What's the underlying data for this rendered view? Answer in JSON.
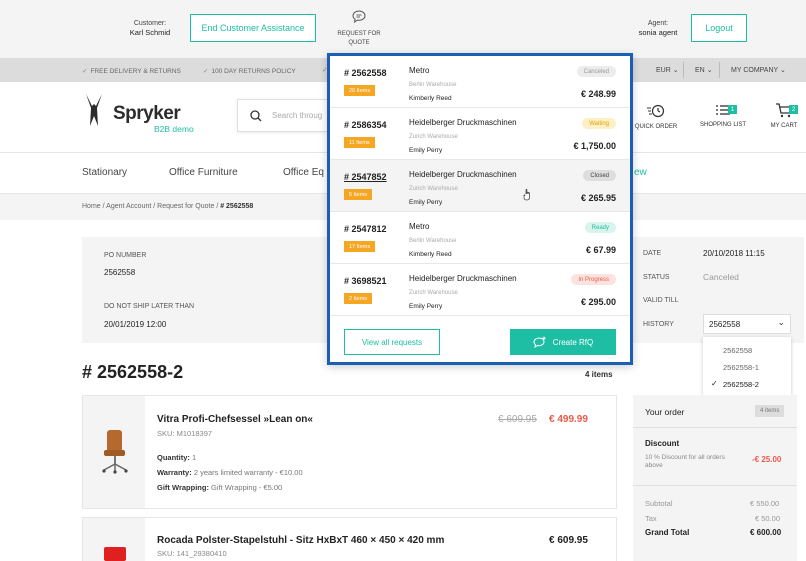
{
  "topbar": {
    "customer_label": "Customer:",
    "customer_name": "Karl Schmid",
    "end_assistance": "End Customer Assistance",
    "rfq_label_1": "REQUEST FOR",
    "rfq_label_2": "QUOTE",
    "agent_label": "Agent:",
    "agent_name": "sonia agent",
    "logout": "Logout"
  },
  "promo": {
    "delivery": "FREE DELIVERY & RETURNS",
    "returns": "100 DAY RETURNS POLICY",
    "currency": "EUR",
    "language": "EN",
    "company": "MY COMPANY"
  },
  "header": {
    "logo_text": "Spryker",
    "logo_sub": "B2B demo",
    "search_placeholder": "Search throug",
    "quick_order": "QUICK ORDER",
    "shopping_list": "SHOPPING LIST",
    "shopping_list_count": "1",
    "my_cart": "MY CART",
    "cart_count": "2"
  },
  "nav": {
    "items": [
      "Stationary",
      "Office Furniture",
      "Office Eq"
    ],
    "partial": "ew"
  },
  "breadcrumb": {
    "items": [
      "Home",
      "Agent Account",
      "Request for Quote",
      "# 2562558"
    ]
  },
  "meta": {
    "po_label": "PO NUMBER",
    "po_value": "2562558",
    "ship_label": "DO NOT SHIP LATER THAN",
    "ship_value": "20/01/2019 12:00",
    "date_label": "DATE",
    "date_value": "20/10/2018 11:15",
    "status_label": "STATUS",
    "status_value": "Canceled",
    "valid_label": "VALID TILL",
    "history_label": "HISTORY",
    "history_value": "2562558",
    "history_options": [
      "2562558",
      "2562558-1",
      "2562558-2"
    ]
  },
  "quote": {
    "title": "# 2562558-2",
    "items_count": "4 items"
  },
  "products": [
    {
      "name": "Vitra Profi-Chefsessel »Lean on«",
      "sku": "SKU: M1018397",
      "old_price": "€ 609.95",
      "price": "€ 499.99",
      "qty_label": "Quantity:",
      "qty": "1",
      "warranty_label": "Warranty:",
      "warranty": "2 years limited warranty - €10.00",
      "gift_label": "Gift Wrapping:",
      "gift": "Gift Wrapping - €5.00"
    },
    {
      "name": "Rocada Polster-Stapelstuhl - Sitz HxBxT 460 × 450 × 420 mm",
      "sku": "SKU: 141_29380410",
      "price": "€ 609.95"
    }
  ],
  "summary": {
    "your_order": "Your order",
    "items_badge": "4 items",
    "discount_label": "Discount",
    "discount_desc": "10 % Discount for all orders above",
    "discount_value": "-€ 25.00",
    "subtotal_label": "Subtotal",
    "subtotal_value": "€ 550.00",
    "tax_label": "Tax",
    "tax_value": "€ 50.00",
    "grand_label": "Grand Total",
    "grand_value": "€ 600.00"
  },
  "popup": {
    "requests": [
      {
        "number": "# 2562558",
        "items": "20 Items",
        "company": "Metro",
        "warehouse": "Berlin Warehouse",
        "person": "Kimberly Reed",
        "status": "Canceled",
        "price": "€ 248.99",
        "status_bg": "#ececec",
        "status_fg": "#999999"
      },
      {
        "number": "# 2586354",
        "items": "11 Items",
        "company": "Heidelberger Druckmaschinen",
        "warehouse": "Zurich Warehouse",
        "person": "Emily Perry",
        "status": "Waiting",
        "price": "€ 1,750.00",
        "status_bg": "#fdf0c6",
        "status_fg": "#e0a100"
      },
      {
        "number": "# 2547852",
        "items": "5 Items",
        "company": "Heidelberger Druckmaschinen",
        "warehouse": "Zurich Warehouse",
        "person": "Emily Perry",
        "status": "Closed",
        "price": "€ 265.95",
        "status_bg": "#dedede",
        "status_fg": "#444444"
      },
      {
        "number": "# 2547812",
        "items": "17 Items",
        "company": "Metro",
        "warehouse": "Berlin Warehouse",
        "person": "Kimberly Reed",
        "status": "Ready",
        "price": "€ 67.99",
        "status_bg": "#d9f3ed",
        "status_fg": "#1ebea5"
      },
      {
        "number": "# 3698521",
        "items": "2 Items",
        "company": "Heidelberger Druckmaschinen",
        "warehouse": "Zurich Warehouse",
        "person": "Emily Perry",
        "status": "In Progress",
        "price": "€ 295.00",
        "status_bg": "#fde3df",
        "status_fg": "#ec5a49"
      }
    ],
    "view_all": "View all requests",
    "create_rfq": "Create RfQ"
  },
  "colors": {
    "accent": "#1ebea5",
    "popup_border": "#1b5fb5",
    "price_red": "#ec5a49",
    "badge_orange": "#f5a623"
  }
}
